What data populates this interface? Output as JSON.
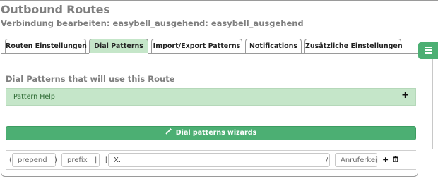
{
  "header": {
    "title": "Outbound Routes",
    "subtitle": "Verbindung bearbeiten: easybell_ausgehend: easybell_ausgehend"
  },
  "tabs": [
    {
      "label": "Routen Einstellungen",
      "active": false
    },
    {
      "label": "Dial Patterns",
      "active": true
    },
    {
      "label": "Import/Export Patterns",
      "active": false
    },
    {
      "label": "Notifications",
      "active": false
    },
    {
      "label": "Zusätzliche Einstellungen",
      "active": false
    }
  ],
  "section": {
    "heading": "Dial Patterns that will use this Route"
  },
  "pattern_help": {
    "label": "Pattern Help",
    "toggle_icon": "plus-icon"
  },
  "wizard_button": {
    "label": "Dial patterns wizards",
    "icon": "magic-wand-icon"
  },
  "pattern_row": {
    "open_paren": "(",
    "close_paren": ")",
    "pipe": "|",
    "open_bracket": "[",
    "slash": "/",
    "close_bracket": "]",
    "prepend_placeholder": "prepend",
    "prefix_placeholder": "prefix",
    "match_value": "X.",
    "callerid_placeholder": "Anruferkennung",
    "add_icon": "plus-icon",
    "delete_icon": "trash-icon"
  },
  "side_button": {
    "icon": "list-icon"
  },
  "colors": {
    "accent_green": "#4caf73",
    "light_green": "#c5e6c9",
    "title_gray": "#7f7f7f"
  }
}
